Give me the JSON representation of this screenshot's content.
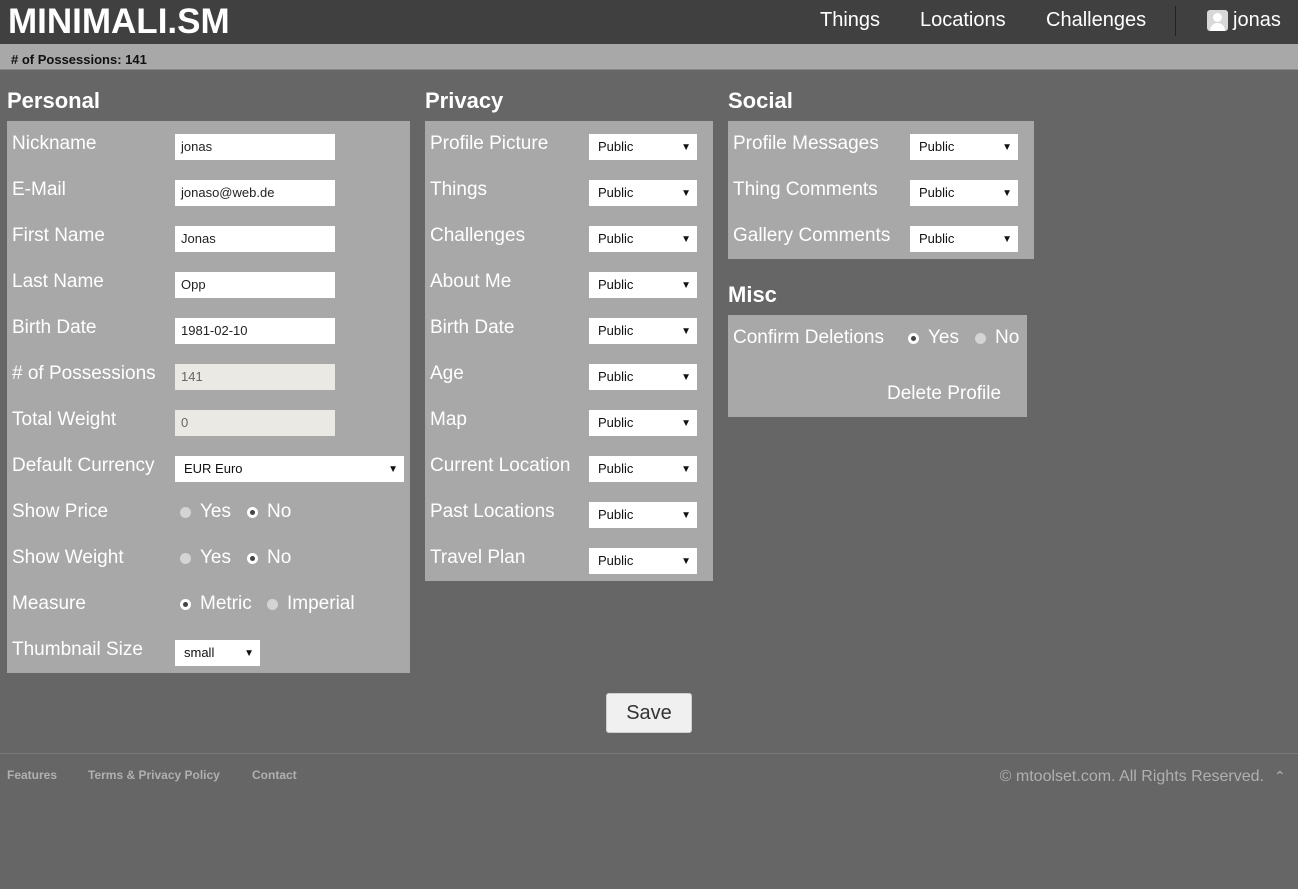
{
  "header": {
    "logo": "MINIMALI.SM",
    "nav": [
      "Things",
      "Locations",
      "Challenges"
    ],
    "user": "jonas"
  },
  "status": {
    "possessions_text": "# of Possessions: 141"
  },
  "personal": {
    "title": "Personal",
    "nickname": {
      "label": "Nickname",
      "value": "jonas"
    },
    "email": {
      "label": "E-Mail",
      "value": "jonaso@web.de"
    },
    "first_name": {
      "label": "First Name",
      "value": "Jonas"
    },
    "last_name": {
      "label": "Last Name",
      "value": "Opp"
    },
    "birth_date": {
      "label": "Birth Date",
      "value": "1981-02-10"
    },
    "possessions": {
      "label": "# of Possessions",
      "value": "141"
    },
    "total_weight": {
      "label": "Total Weight",
      "value": "0"
    },
    "currency": {
      "label": "Default Currency",
      "value": "EUR Euro"
    },
    "show_price": {
      "label": "Show Price",
      "yes": "Yes",
      "no": "No",
      "selected": "No"
    },
    "show_weight": {
      "label": "Show Weight",
      "yes": "Yes",
      "no": "No",
      "selected": "No"
    },
    "measure": {
      "label": "Measure",
      "metric": "Metric",
      "imperial": "Imperial",
      "selected": "Metric"
    },
    "thumbnail": {
      "label": "Thumbnail Size",
      "value": "small"
    }
  },
  "privacy": {
    "title": "Privacy",
    "rows": [
      {
        "label": "Profile Picture",
        "value": "Public"
      },
      {
        "label": "Things",
        "value": "Public"
      },
      {
        "label": "Challenges",
        "value": "Public"
      },
      {
        "label": "About Me",
        "value": "Public"
      },
      {
        "label": "Birth Date",
        "value": "Public"
      },
      {
        "label": "Age",
        "value": "Public"
      },
      {
        "label": "Map",
        "value": "Public"
      },
      {
        "label": "Current Location",
        "value": "Public"
      },
      {
        "label": "Past Locations",
        "value": "Public"
      },
      {
        "label": "Travel Plan",
        "value": "Public"
      }
    ]
  },
  "social": {
    "title": "Social",
    "rows": [
      {
        "label": "Profile Messages",
        "value": "Public"
      },
      {
        "label": "Thing Comments",
        "value": "Public"
      },
      {
        "label": "Gallery Comments",
        "value": "Public"
      }
    ]
  },
  "misc": {
    "title": "Misc",
    "confirm": {
      "label": "Confirm Deletions",
      "yes": "Yes",
      "no": "No",
      "selected": "Yes"
    },
    "delete": "Delete Profile"
  },
  "save": "Save",
  "footer": {
    "links": [
      "Features",
      "Terms & Privacy Policy",
      "Contact"
    ],
    "copyright": "© mtoolset.com. All Rights Reserved."
  },
  "colors": {
    "background": "#666666",
    "header": "#404040",
    "panel": "#a8a8a8"
  }
}
